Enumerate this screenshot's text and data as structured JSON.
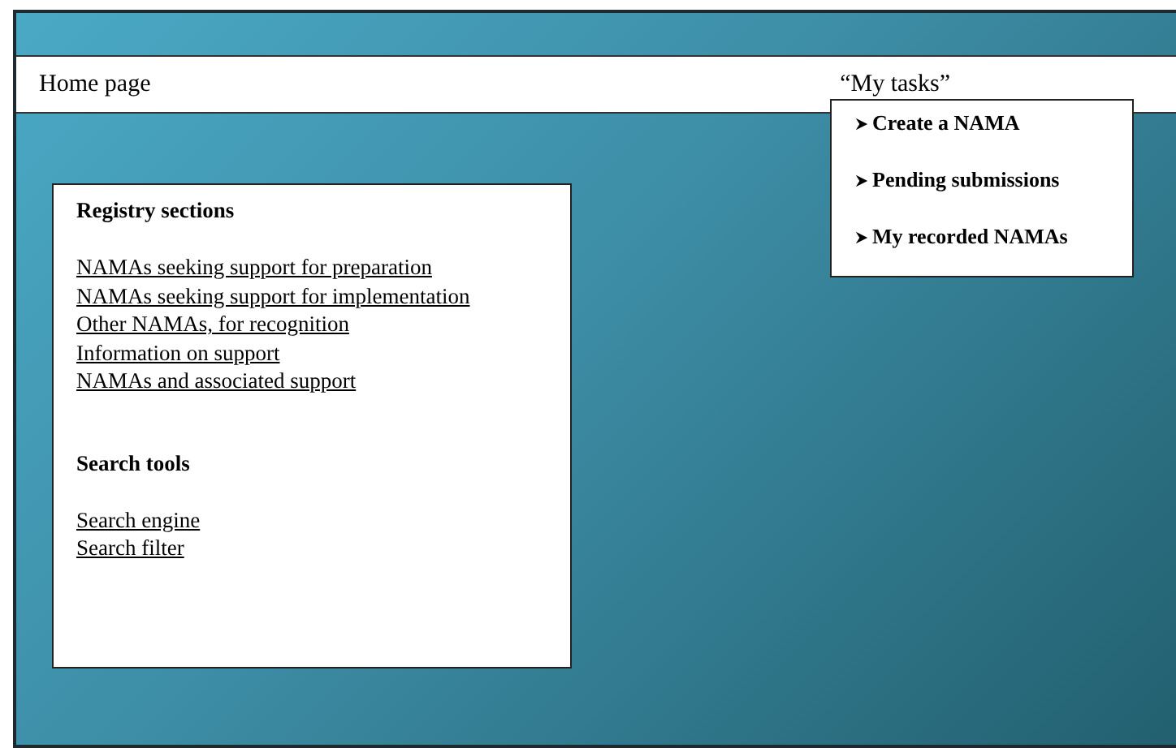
{
  "nav_bar": {
    "home": "Home page",
    "my_tasks": "“My tasks”"
  },
  "tasks_menu": [
    "Create a NAMA",
    "Pending submissions",
    "My recorded NAMAs"
  ],
  "registry_sections": {
    "title": "Registry sections",
    "links": [
      "NAMAs seeking support for preparation",
      "NAMAs seeking support for implementation",
      "Other NAMAs, for recognition",
      "Information on support",
      "NAMAs and associated support"
    ]
  },
  "search_tools": {
    "title": "Search tools",
    "links": [
      "Search engine",
      "Search filter"
    ]
  }
}
